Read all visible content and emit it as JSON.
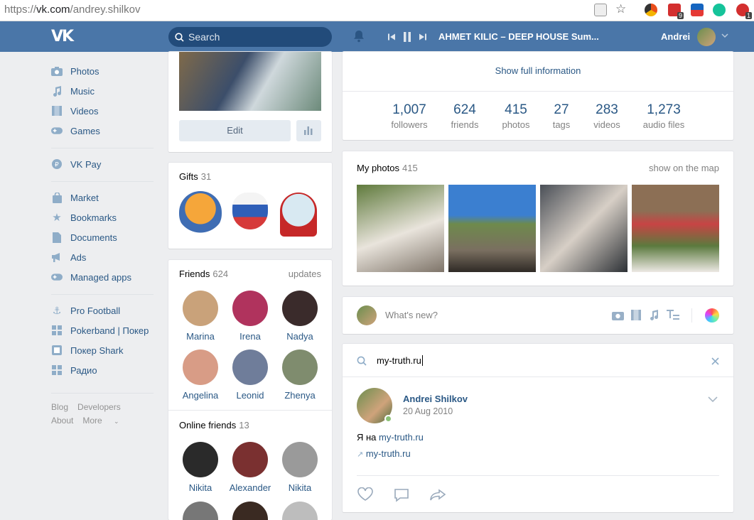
{
  "browser": {
    "scheme": "https://",
    "host": "vk.com",
    "path": "/andrey.shilkov",
    "ext_badges": [
      "9",
      "1"
    ]
  },
  "header": {
    "search_placeholder": "Search",
    "track": "AHMET KILIC – DEEP HOUSE Sum...",
    "user_name": "Andrei"
  },
  "nav": {
    "group1": [
      {
        "label": "Photos",
        "icon": "camera-icon"
      },
      {
        "label": "Music",
        "icon": "music-note-icon"
      },
      {
        "label": "Videos",
        "icon": "film-icon"
      },
      {
        "label": "Games",
        "icon": "gamepad-icon"
      }
    ],
    "group2": [
      {
        "label": "VK Pay",
        "icon": "vkpay-icon"
      }
    ],
    "group3": [
      {
        "label": "Market",
        "icon": "bag-icon"
      },
      {
        "label": "Bookmarks",
        "icon": "star-icon"
      },
      {
        "label": "Documents",
        "icon": "document-icon"
      },
      {
        "label": "Ads",
        "icon": "megaphone-icon"
      },
      {
        "label": "Managed apps",
        "icon": "gamepad-icon"
      }
    ],
    "group4": [
      {
        "label": "Pro Football",
        "icon": "anchor-icon"
      },
      {
        "label": "Pokerband | Покер",
        "icon": "apps-icon"
      },
      {
        "label": "Покер Shark",
        "icon": "app-icon"
      },
      {
        "label": "Радио",
        "icon": "apps-icon"
      }
    ],
    "footer": {
      "blog": "Blog",
      "developers": "Developers",
      "about": "About",
      "more": "More"
    }
  },
  "profile": {
    "edit_label": "Edit"
  },
  "gifts": {
    "title": "Gifts",
    "count": "31"
  },
  "friends": {
    "title": "Friends",
    "count": "624",
    "updates": "updates",
    "items": [
      {
        "name": "Marina",
        "color": "#c9a27a"
      },
      {
        "name": "Irena",
        "color": "#b0335d"
      },
      {
        "name": "Nadya",
        "color": "#3a2b2b"
      },
      {
        "name": "Angelina",
        "color": "#d89c86"
      },
      {
        "name": "Leonid",
        "color": "#6f7d9a"
      },
      {
        "name": "Zhenya",
        "color": "#7f8c6e"
      }
    ]
  },
  "online": {
    "title": "Online friends",
    "count": "13",
    "items": [
      {
        "name": "Nikita",
        "color": "#2a2a2a"
      },
      {
        "name": "Alexander",
        "color": "#7a3030"
      },
      {
        "name": "Nikita",
        "color": "#9a9a9a"
      }
    ]
  },
  "info": {
    "show_full": "Show full information"
  },
  "stats": [
    {
      "n": "1,007",
      "l": "followers"
    },
    {
      "n": "624",
      "l": "friends"
    },
    {
      "n": "415",
      "l": "photos"
    },
    {
      "n": "27",
      "l": "tags"
    },
    {
      "n": "283",
      "l": "videos"
    },
    {
      "n": "1,273",
      "l": "audio files"
    }
  ],
  "photos": {
    "title": "My photos",
    "count": "415",
    "map": "show on the map"
  },
  "composer": {
    "placeholder": "What's new?"
  },
  "wall_search": {
    "value": "my-truth.ru"
  },
  "post": {
    "author": "Andrei Shilkov",
    "date": "20 Aug 2010",
    "text_prefix": "Я на",
    "text_link": "my-truth.ru",
    "attach_link": "my-truth.ru"
  },
  "colors": {
    "header": "#4a76a8",
    "link": "#2a5885",
    "bg": "#edeef0"
  }
}
